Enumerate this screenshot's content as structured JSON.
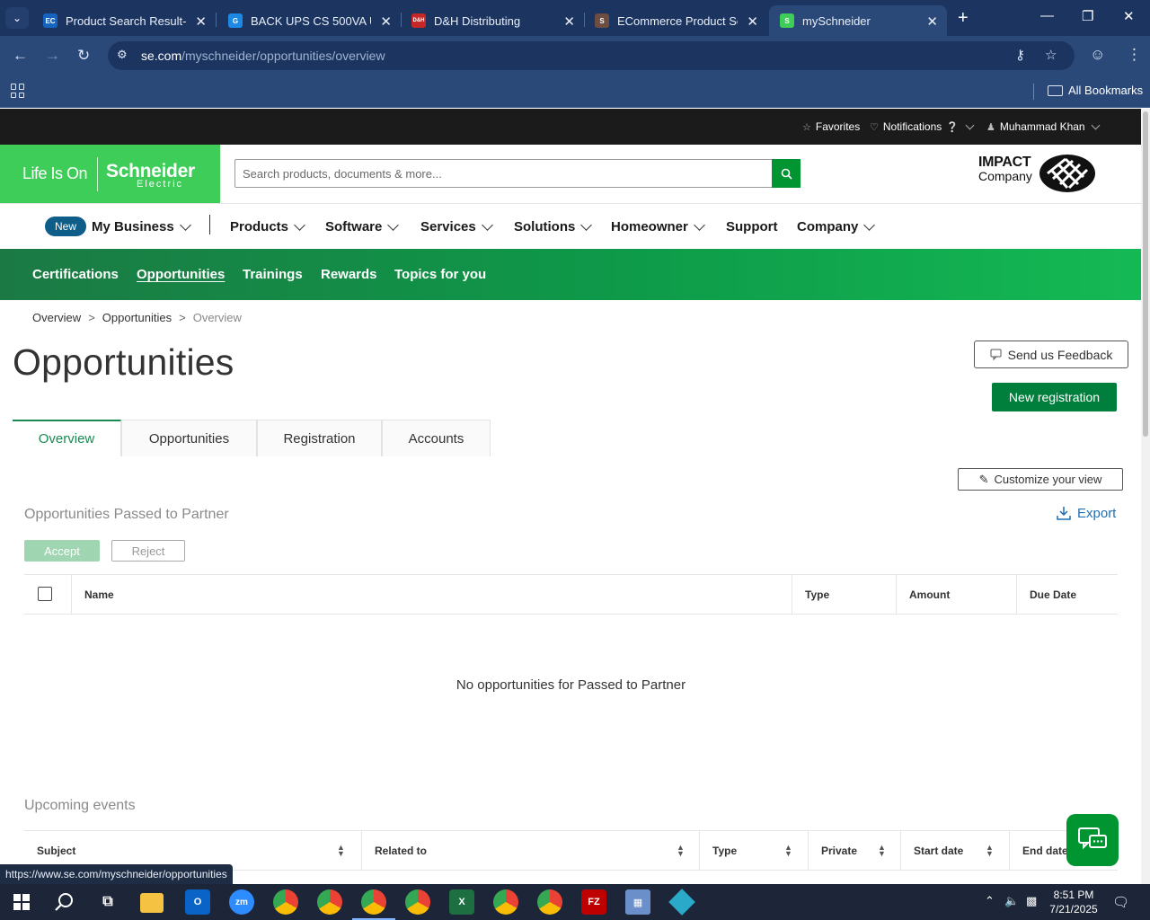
{
  "browser": {
    "tabs": [
      {
        "title": "Product Search Result- EC",
        "favicon": "EC",
        "color": "#1565c0"
      },
      {
        "title": "BACK UPS CS 500VA USB",
        "favicon": "G",
        "color": "#1e88e5"
      },
      {
        "title": "D&H Distributing",
        "favicon": "D&H",
        "color": "#c62828"
      },
      {
        "title": "ECommerce Product Sear",
        "favicon": "S",
        "color": "#6d4c41"
      },
      {
        "title": "mySchneider",
        "favicon": "S",
        "color": "#3dcd58"
      }
    ],
    "url_domain": "se.com",
    "url_path": "/myschneider/opportunities/overview",
    "all_bookmarks": "All Bookmarks"
  },
  "utility": {
    "favorites": "Favorites",
    "notifications": "Notifications",
    "user": "Muhammad Khan"
  },
  "header": {
    "tagline": "Life Is On",
    "brand": "Schneider",
    "brand_sub": "Electric",
    "search_placeholder": "Search products, documents & more...",
    "impact_line1": "IMPACT",
    "impact_line2": "Company"
  },
  "mainnav": {
    "new_badge": "New",
    "items": [
      "My Business",
      "Products",
      "Software",
      "Services",
      "Solutions",
      "Homeowner",
      "Support",
      "Company"
    ]
  },
  "subnav": {
    "items": [
      "Certifications",
      "Opportunities",
      "Trainings",
      "Rewards",
      "Topics for you"
    ]
  },
  "breadcrumb": {
    "items": [
      "Overview",
      "Opportunities",
      "Overview"
    ],
    "separator": ">"
  },
  "page": {
    "title": "Opportunities",
    "feedback_label": "Send us Feedback",
    "new_registration_label": "New registration",
    "tabs": [
      "Overview",
      "Opportunities",
      "Registration",
      "Accounts"
    ],
    "customize_label": "Customize your view",
    "export_label": "Export"
  },
  "passed_section": {
    "title": "Opportunities Passed to Partner",
    "accept_label": "Accept",
    "reject_label": "Reject",
    "columns": [
      "Name",
      "Type",
      "Amount",
      "Due Date"
    ],
    "empty_message": "No opportunities for Passed to Partner"
  },
  "events_section": {
    "title": "Upcoming events",
    "columns": [
      "Subject",
      "Related to",
      "Type",
      "Private",
      "Start date",
      "End date"
    ]
  },
  "status_url": "https://www.se.com/myschneider/opportunities",
  "taskbar": {
    "time": "8:51 PM",
    "date": "7/21/2025"
  },
  "colors": {
    "brand_green": "#3dcd58",
    "button_green": "#007f3c",
    "browser_dark": "#1c3560",
    "link_blue": "#1f6fb2"
  }
}
